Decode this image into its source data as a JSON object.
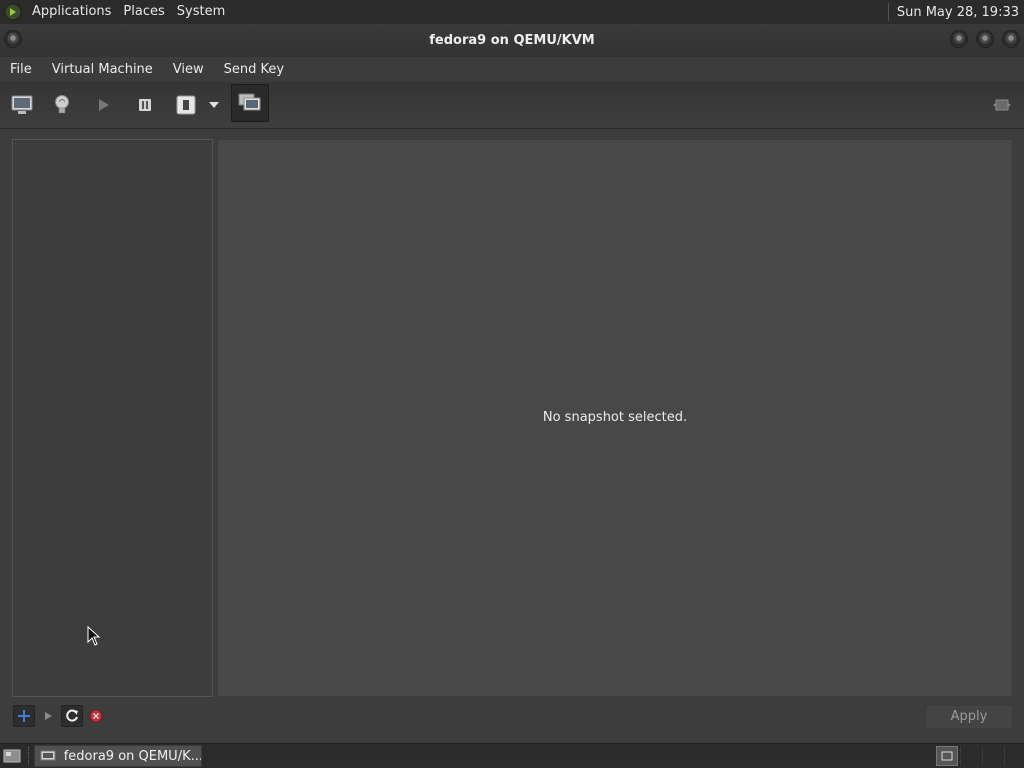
{
  "top_panel": {
    "menus": [
      "Applications",
      "Places",
      "System"
    ],
    "clock": "Sun May 28, 19:33"
  },
  "window": {
    "title": "fedora9 on QEMU/KVM"
  },
  "menubar": {
    "items": [
      "File",
      "Virtual Machine",
      "View",
      "Send Key"
    ]
  },
  "toolbar": {
    "buttons": [
      "console-icon",
      "details-lightbulb-icon",
      "run-icon",
      "pause-icon",
      "shutdown-icon",
      "dropdown-arrow-icon",
      "snapshots-icon",
      "fullscreen-icon"
    ],
    "active": "snapshots-icon"
  },
  "snapshots": {
    "empty_message": "No snapshot selected.",
    "actions": [
      "add-snapshot-icon",
      "start-snapshot-icon",
      "refresh-icon",
      "delete-snapshot-icon"
    ],
    "apply_label": "Apply"
  },
  "taskbar": {
    "task_label": "fedora9 on QEMU/K...",
    "task_full_title": "fedora9 on QEMU/KVM"
  },
  "colors": {
    "background": "#3d3d3d",
    "panel": "#2b2b2b",
    "detail_pane": "#484848",
    "add_icon": "#3d7ed9",
    "delete_icon": "#c0303a"
  }
}
